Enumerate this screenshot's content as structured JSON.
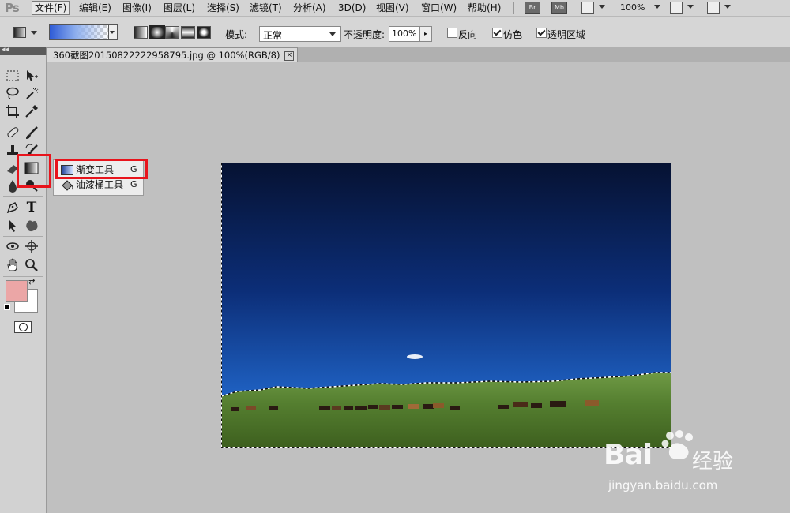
{
  "app": {
    "logo": "Ps"
  },
  "menu": {
    "items": [
      "文件(F)",
      "编辑(E)",
      "图像(I)",
      "图层(L)",
      "选择(S)",
      "滤镜(T)",
      "分析(A)",
      "3D(D)",
      "视图(V)",
      "窗口(W)",
      "帮助(H)"
    ],
    "bridge": "Br",
    "minibridge": "Mb",
    "zoom": "100%"
  },
  "options": {
    "mode_label": "模式:",
    "mode_value": "正常",
    "opacity_label": "不透明度:",
    "opacity_value": "100%",
    "reverse_label": "反向",
    "reverse_checked": false,
    "dither_label": "仿色",
    "dither_checked": true,
    "transparency_label": "透明区域",
    "transparency_checked": true
  },
  "document": {
    "tab_title": "360截图20150822222958795.jpg @ 100%(RGB/8)",
    "close": "×"
  },
  "toolbox": {
    "type_tool": "T"
  },
  "flyout": {
    "items": [
      {
        "label": "渐变工具",
        "shortcut": "G"
      },
      {
        "label": "油漆桶工具",
        "shortcut": "G"
      }
    ]
  },
  "colors": {
    "foreground": "#eba6a6",
    "background": "#ffffff",
    "highlight": "#e8141c"
  },
  "watermark": {
    "brand": "Bai",
    "brand2": "经验",
    "url": "jingyan.baidu.com"
  }
}
